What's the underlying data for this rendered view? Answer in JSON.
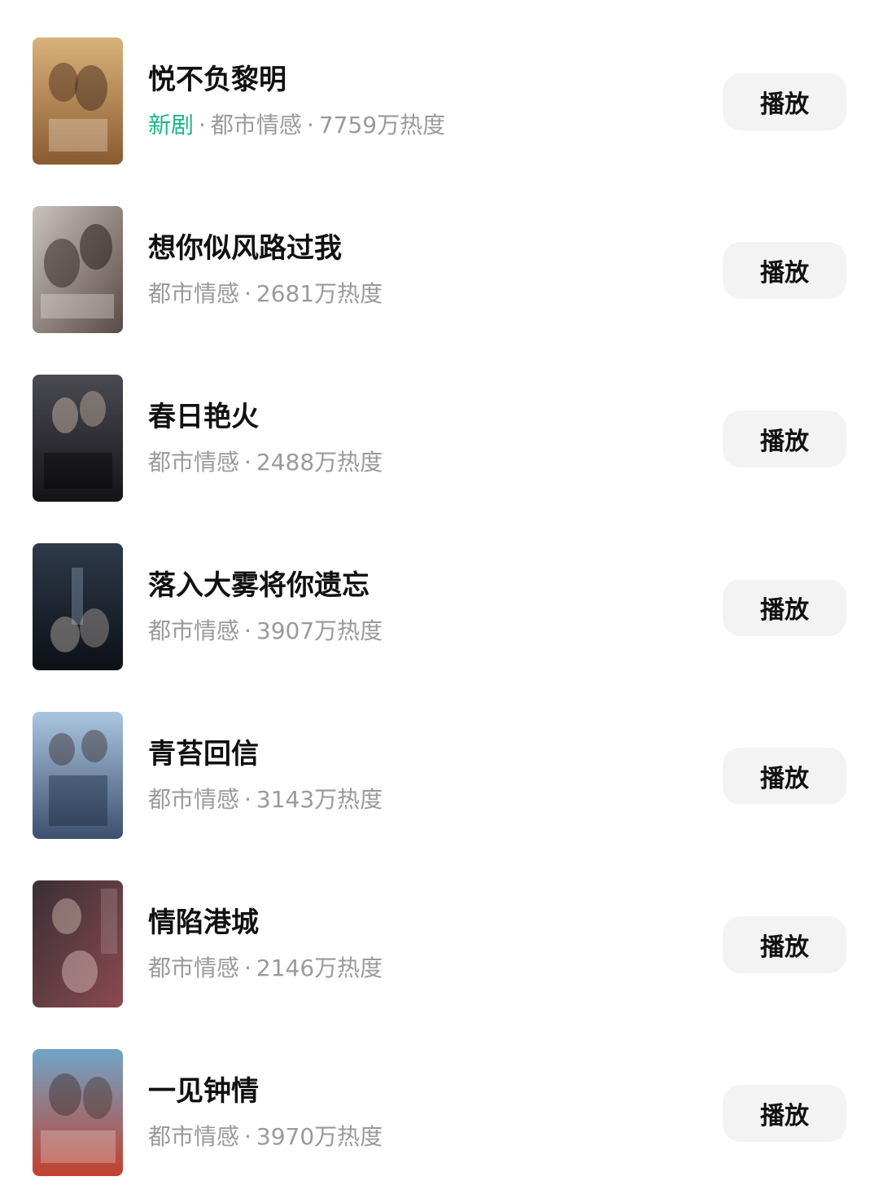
{
  "dramas": [
    {
      "title": "悦不负黎明",
      "tag": "新剧",
      "genre": "都市情感",
      "heat": "7759万热度",
      "play_label": "播放",
      "poster_colors": [
        "#d9b27a",
        "#8a5a30"
      ]
    },
    {
      "title": "想你似风路过我",
      "tag": "",
      "genre": "都市情感",
      "heat": "2681万热度",
      "play_label": "播放",
      "poster_colors": [
        "#c9c2bd",
        "#5b4a45"
      ]
    },
    {
      "title": "春日艳火",
      "tag": "",
      "genre": "都市情感",
      "heat": "2488万热度",
      "play_label": "播放",
      "poster_colors": [
        "#4a4a52",
        "#141418"
      ]
    },
    {
      "title": "落入大雾将你遗忘",
      "tag": "",
      "genre": "都市情感",
      "heat": "3907万热度",
      "play_label": "播放",
      "poster_colors": [
        "#2e3a4a",
        "#0c1016"
      ]
    },
    {
      "title": "青苔回信",
      "tag": "",
      "genre": "都市情感",
      "heat": "3143万热度",
      "play_label": "播放",
      "poster_colors": [
        "#aac6e0",
        "#3c4f6e"
      ]
    },
    {
      "title": "情陷港城",
      "tag": "",
      "genre": "都市情感",
      "heat": "2146万热度",
      "play_label": "播放",
      "poster_colors": [
        "#3a2f35",
        "#8a4a50"
      ]
    },
    {
      "title": "一见钟情",
      "tag": "",
      "genre": "都市情感",
      "heat": "3970万热度",
      "play_label": "播放",
      "poster_colors": [
        "#6fa6c8",
        "#c2402e"
      ]
    }
  ],
  "separator": "·",
  "colors": {
    "tag_green": "#17b68a",
    "meta_gray": "#9a9a9a",
    "button_bg": "#f3f3f3"
  }
}
